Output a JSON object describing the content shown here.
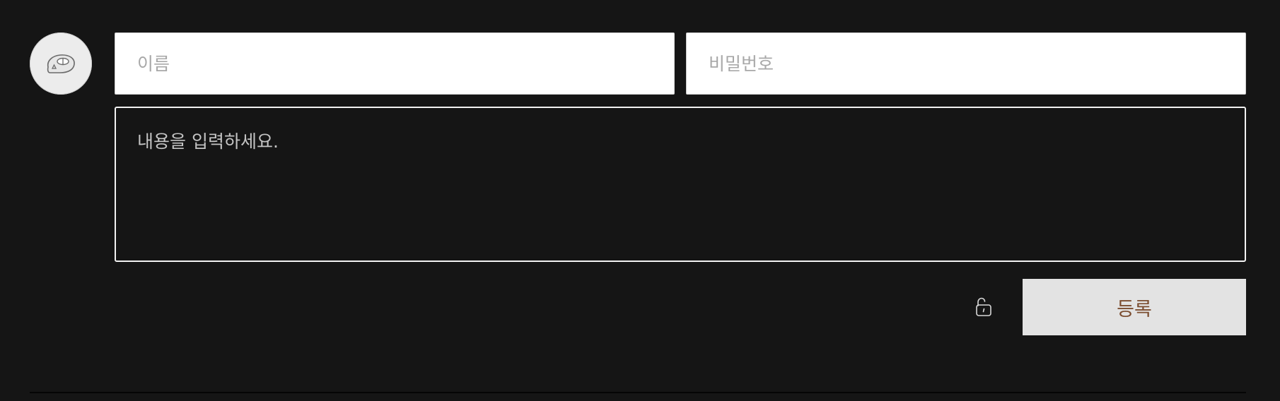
{
  "comment_form": {
    "avatar_icon": "default-avatar-icon",
    "name_field": {
      "placeholder": "이름",
      "value": ""
    },
    "password_field": {
      "placeholder": "비밀번호",
      "value": ""
    },
    "content_field": {
      "placeholder": "내용을 입력하세요.",
      "value": ""
    },
    "secret_toggle_icon": "unlock-icon",
    "submit_label": "등록"
  },
  "colors": {
    "background": "#151515",
    "field_background": "#ffffff",
    "button_background": "#e3e3e3",
    "button_text": "#7b4d30"
  }
}
